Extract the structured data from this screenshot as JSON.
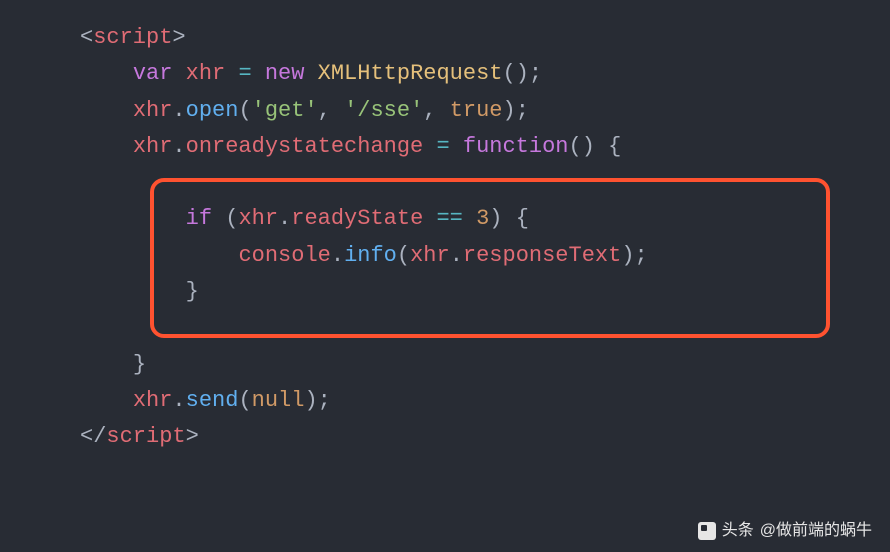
{
  "code": {
    "tagOpen1": "<",
    "tagName": "script",
    "tagOpen2": ">",
    "tagClose1": "</",
    "tagClose2": ">",
    "kw_var": "var",
    "var_xhr": "xhr",
    "op_assign": "=",
    "kw_new": "new",
    "cls_xhr": "XMLHttpRequest",
    "parenPair": "()",
    "semi": ";",
    "dot": ".",
    "method_open": "open",
    "lparen": "(",
    "rparen": ")",
    "str_get": "'get'",
    "comma": ",",
    "str_sse": "'/sse'",
    "bool_true": "true",
    "prop_onready": "onreadystatechange",
    "kw_function": "function",
    "lbrace": "{",
    "rbrace": "}",
    "kw_if": "if",
    "prop_readyState": "readyState",
    "op_eq": "==",
    "num_3": "3",
    "var_console": "console",
    "method_info": "info",
    "prop_responseText": "responseText",
    "method_send": "send",
    "kw_null": "null"
  },
  "watermark": {
    "label": "头条",
    "handle": "@做前端的蜗牛"
  }
}
